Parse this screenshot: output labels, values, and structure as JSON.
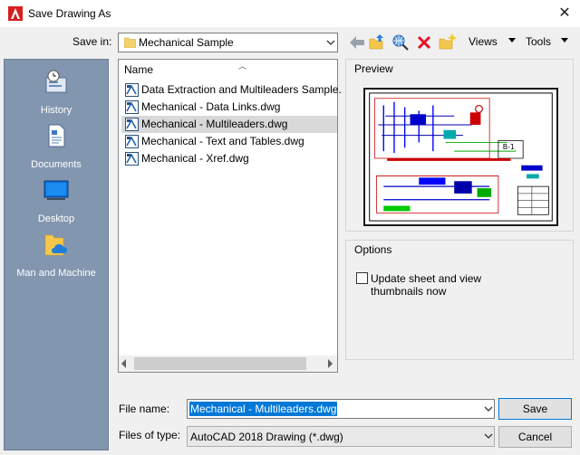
{
  "window": {
    "title": "Save Drawing As",
    "close_glyph": "✕"
  },
  "save_in": {
    "label": "Save in:",
    "value": "Mechanical Sample"
  },
  "toolbar": {
    "icons": [
      "back-arrow-icon",
      "up-folder-icon",
      "search-web-icon",
      "delete-icon",
      "new-folder-icon"
    ],
    "views_label": "Views",
    "tools_label": "Tools"
  },
  "places": [
    {
      "label": "History",
      "icon": "history-icon"
    },
    {
      "label": "Documents",
      "icon": "documents-icon"
    },
    {
      "label": "Desktop",
      "icon": "desktop-icon"
    },
    {
      "label": "Man and Machine",
      "icon": "onedrive-folder-icon"
    }
  ],
  "file_list": {
    "column_header": "Name",
    "files": [
      {
        "name": "Data Extraction and Multileaders Sample.",
        "selected": false
      },
      {
        "name": "Mechanical - Data Links.dwg",
        "selected": false
      },
      {
        "name": "Mechanical - Multileaders.dwg",
        "selected": true
      },
      {
        "name": "Mechanical - Text and Tables.dwg",
        "selected": false
      },
      {
        "name": "Mechanical - Xref.dwg",
        "selected": false
      }
    ]
  },
  "preview": {
    "label": "Preview"
  },
  "options": {
    "label": "Options",
    "update_thumbnails_label": "Update sheet and view thumbnails now",
    "update_thumbnails_checked": false
  },
  "file_name": {
    "label": "File name:",
    "value": "Mechanical - Multileaders.dwg"
  },
  "file_type": {
    "label": "Files of type:",
    "value": "AutoCAD 2018 Drawing (*.dwg)"
  },
  "buttons": {
    "save": "Save",
    "cancel": "Cancel"
  },
  "colors": {
    "accent": "#0078d7",
    "places_bg": "#8396af",
    "selection": "#d9d9d9",
    "delete_red": "#e81123"
  }
}
